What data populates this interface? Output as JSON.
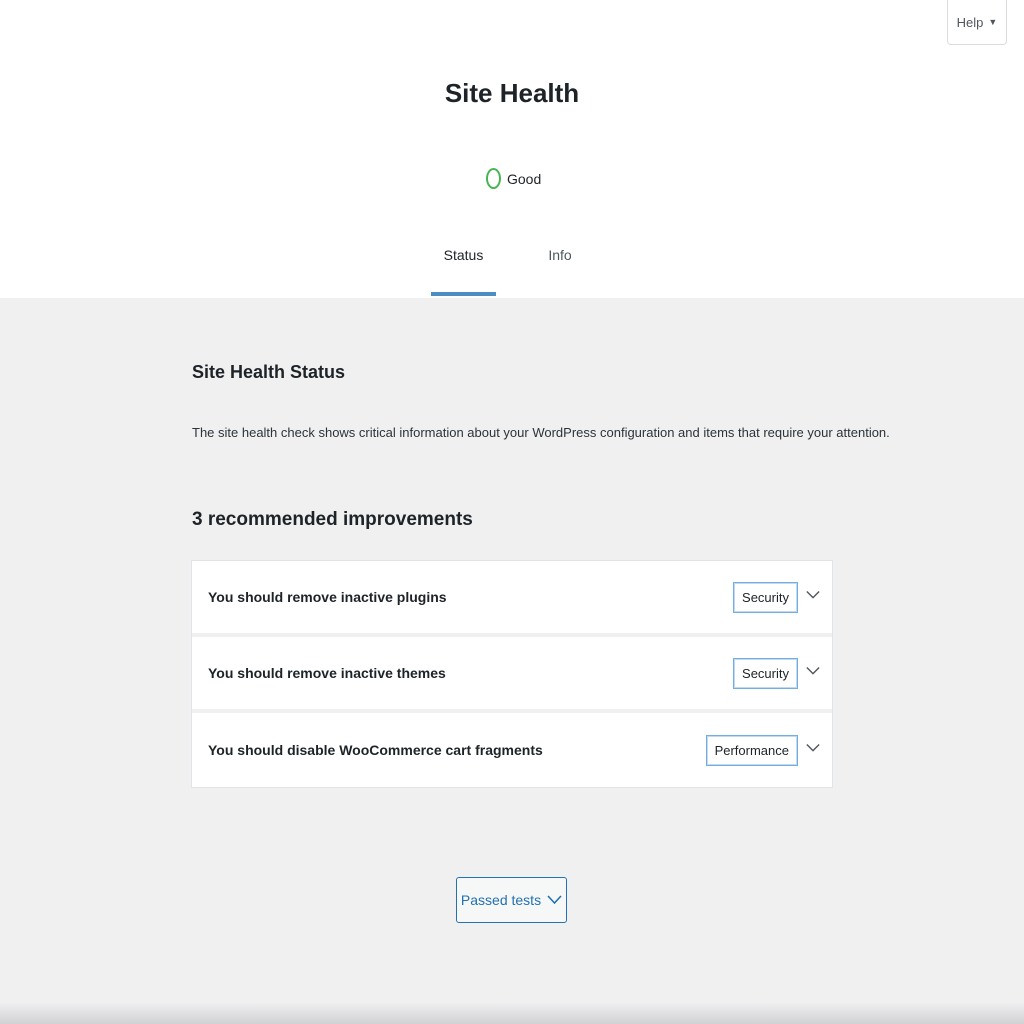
{
  "help": {
    "label": "Help",
    "caret": "▼"
  },
  "page": {
    "title": "Site Health"
  },
  "health": {
    "status_label": "Good",
    "status_color": "#46b450"
  },
  "tabs": [
    {
      "label": "Status",
      "active": true
    },
    {
      "label": "Info",
      "active": false
    }
  ],
  "status_section": {
    "title": "Site Health Status",
    "description": "The site health check shows critical information about your WordPress configuration and items that require your attention.",
    "issues_count_label": "3 recommended improvements"
  },
  "issues": [
    {
      "label": "You should remove inactive plugins",
      "badge": "Security",
      "icon": "chevron-down-icon"
    },
    {
      "label": "You should remove inactive themes",
      "badge": "Security",
      "icon": "chevron-down-icon"
    },
    {
      "label": "You should disable WooCommerce cart fragments",
      "badge": "Performance",
      "icon": "chevron-down-icon"
    }
  ],
  "passed_tests": {
    "label": "Passed tests",
    "icon": "chevron-down-icon"
  },
  "colors": {
    "accent": "#2271b1",
    "badge_border": "#72aee6",
    "good": "#46b450",
    "background": "#f0f0f1"
  }
}
